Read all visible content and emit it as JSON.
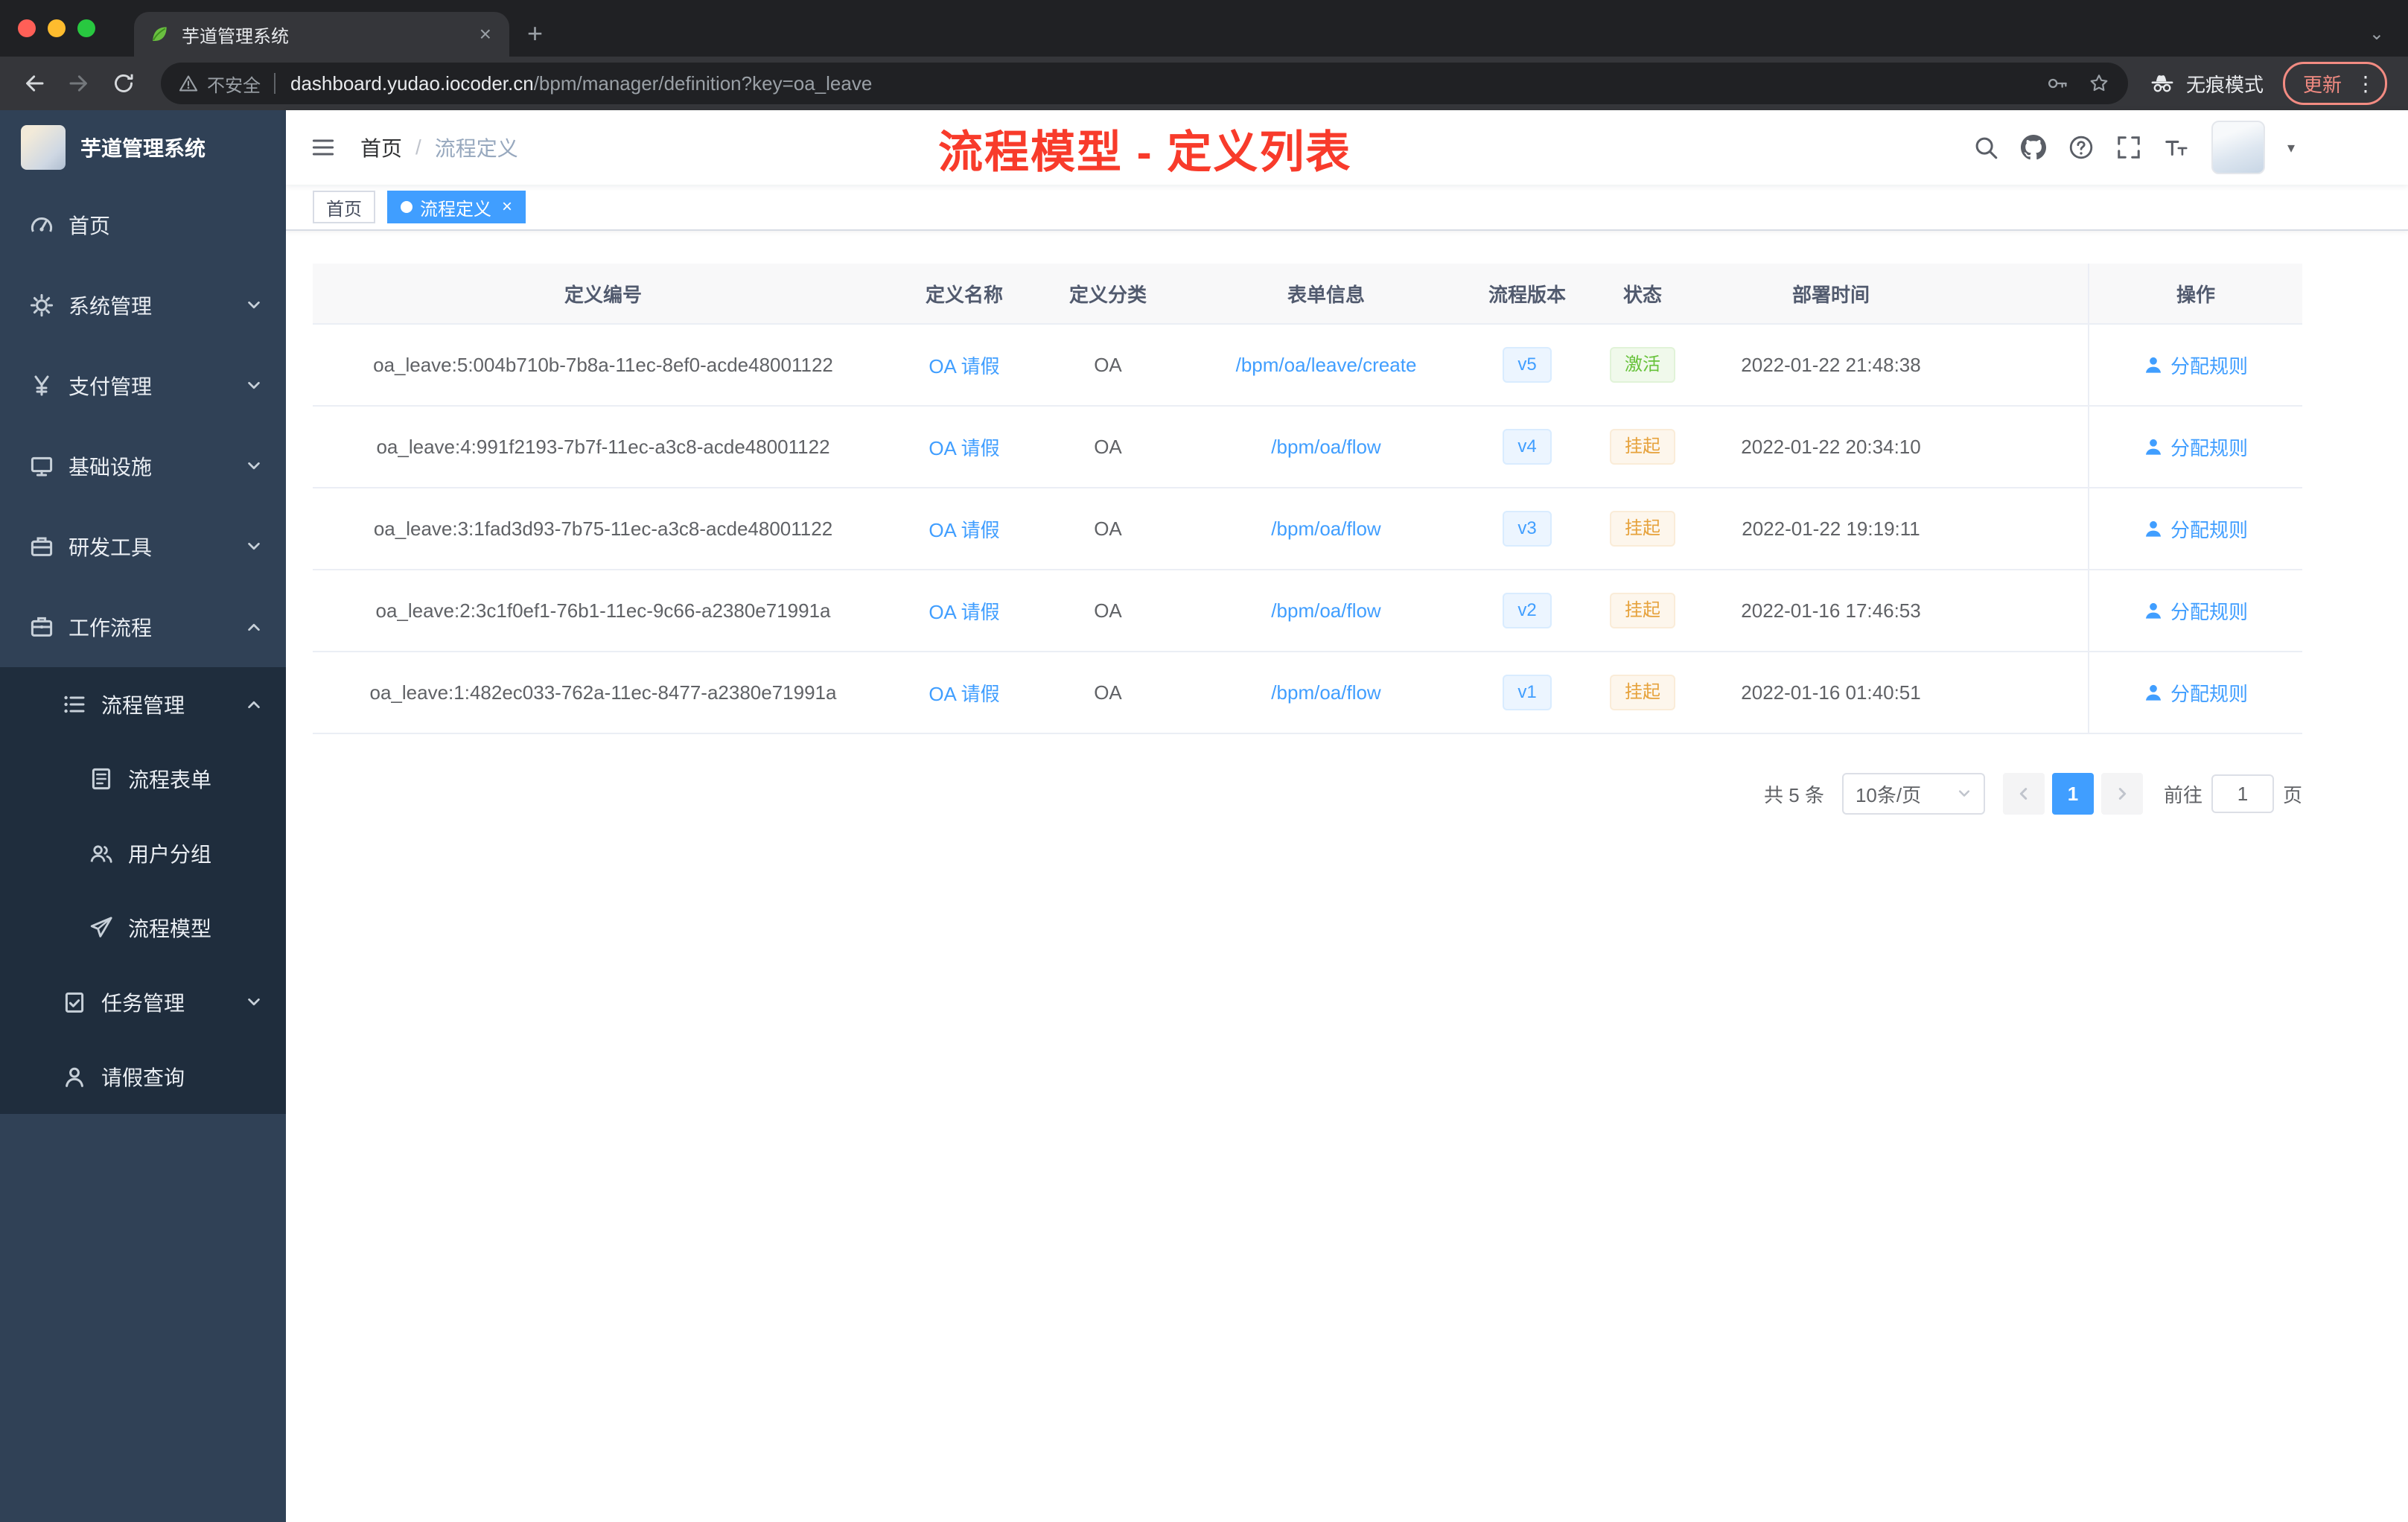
{
  "browser": {
    "tab": {
      "title": "芋道管理系统"
    },
    "address": {
      "security_label": "不安全",
      "domain": "dashboard.yudao.iocoder.cn",
      "path": "/bpm/manager/definition?key=oa_leave"
    },
    "incognito_label": "无痕模式",
    "update_label": "更新"
  },
  "icons": {
    "tab_close": "×",
    "new_tab": "+",
    "menu_dots": "⋮",
    "tab_search_caret": "⌄",
    "avatar_caret": "▾"
  },
  "sidebar": {
    "logo_title": "芋道管理系统",
    "items": [
      {
        "key": "home",
        "label": "首页",
        "icon": "dashboard-icon",
        "level": 1
      },
      {
        "key": "system",
        "label": "系统管理",
        "icon": "gear-icon",
        "level": 1,
        "arrow": "down"
      },
      {
        "key": "payment",
        "label": "支付管理",
        "icon": "yen-icon",
        "level": 1,
        "arrow": "down"
      },
      {
        "key": "infrastructure",
        "label": "基础设施",
        "icon": "monitor-icon",
        "level": 1,
        "arrow": "down"
      },
      {
        "key": "devtools",
        "label": "研发工具",
        "icon": "toolbox-icon",
        "level": 1,
        "arrow": "down"
      },
      {
        "key": "workflow",
        "label": "工作流程",
        "icon": "briefcase-icon",
        "level": 1,
        "arrow": "up"
      },
      {
        "key": "process-manage",
        "label": "流程管理",
        "icon": "list-icon",
        "level": 2,
        "arrow": "up"
      },
      {
        "key": "process-form",
        "label": "流程表单",
        "icon": "form-icon",
        "level": 3
      },
      {
        "key": "user-group",
        "label": "用户分组",
        "icon": "user-group-icon",
        "level": 3
      },
      {
        "key": "process-model",
        "label": "流程模型",
        "icon": "paper-plane-icon",
        "level": 3
      },
      {
        "key": "task-manage",
        "label": "任务管理",
        "icon": "task-icon",
        "level": 2,
        "arrow": "down"
      },
      {
        "key": "leave-query",
        "label": "请假查询",
        "icon": "user-icon",
        "level": 2
      }
    ]
  },
  "navbar": {
    "breadcrumb_home": "首页",
    "breadcrumb_separator": "/",
    "breadcrumb_current": "流程定义"
  },
  "annotation": {
    "text": "流程模型 - 定义列表",
    "color": "#f83b2b"
  },
  "tags": {
    "items": [
      {
        "label": "首页",
        "active": false
      },
      {
        "label": "流程定义",
        "active": true
      }
    ]
  },
  "table": {
    "columns": [
      "定义编号",
      "定义名称",
      "定义分类",
      "表单信息",
      "流程版本",
      "状态",
      "部署时间",
      "操作"
    ],
    "action_label": "分配规则",
    "rows": [
      {
        "id": "oa_leave:5:004b710b-7b8a-11ec-8ef0-acde48001122",
        "name": "OA 请假",
        "category": "OA",
        "form": "/bpm/oa/leave/create",
        "version": "v5",
        "status": "激活",
        "status_type": "success",
        "time": "2022-01-22 21:48:38"
      },
      {
        "id": "oa_leave:4:991f2193-7b7f-11ec-a3c8-acde48001122",
        "name": "OA 请假",
        "category": "OA",
        "form": "/bpm/oa/flow",
        "version": "v4",
        "status": "挂起",
        "status_type": "warning",
        "time": "2022-01-22 20:34:10"
      },
      {
        "id": "oa_leave:3:1fad3d93-7b75-11ec-a3c8-acde48001122",
        "name": "OA 请假",
        "category": "OA",
        "form": "/bpm/oa/flow",
        "version": "v3",
        "status": "挂起",
        "status_type": "warning",
        "time": "2022-01-22 19:19:11"
      },
      {
        "id": "oa_leave:2:3c1f0ef1-76b1-11ec-9c66-a2380e71991a",
        "name": "OA 请假",
        "category": "OA",
        "form": "/bpm/oa/flow",
        "version": "v2",
        "status": "挂起",
        "status_type": "warning",
        "time": "2022-01-16 17:46:53"
      },
      {
        "id": "oa_leave:1:482ec033-762a-11ec-8477-a2380e71991a",
        "name": "OA 请假",
        "category": "OA",
        "form": "/bpm/oa/flow",
        "version": "v1",
        "status": "挂起",
        "status_type": "warning",
        "time": "2022-01-16 01:40:51"
      }
    ]
  },
  "pagination": {
    "total": "共 5 条",
    "page_size": "10条/页",
    "current_page": "1",
    "goto_label": "前往",
    "goto_value": "1",
    "page_unit": "页"
  }
}
